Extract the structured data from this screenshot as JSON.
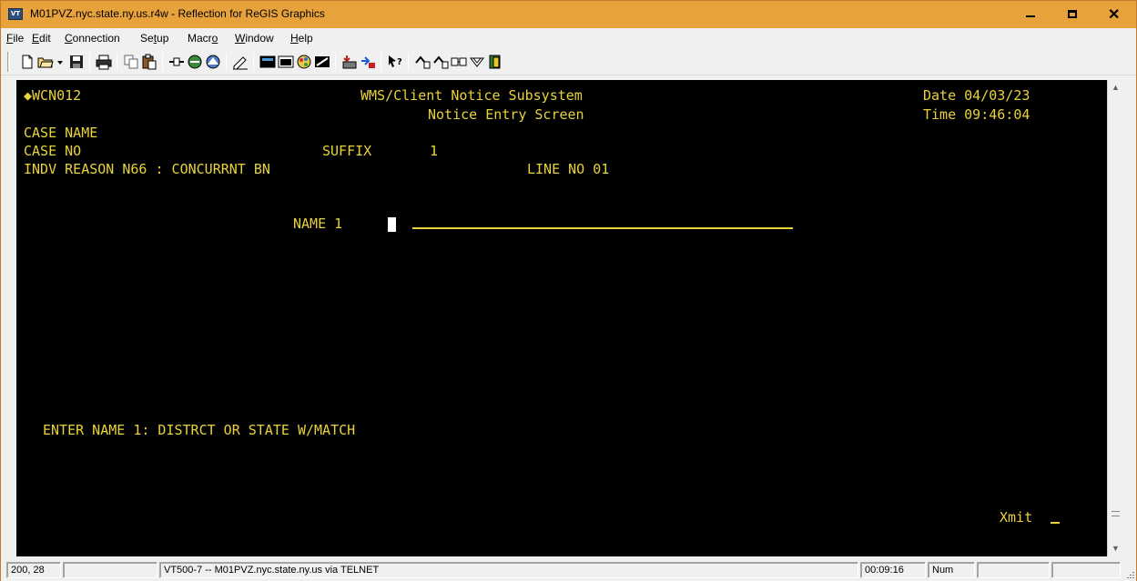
{
  "window": {
    "title": "M01PVZ.nyc.state.ny.us.r4w - Reflection for ReGIS Graphics",
    "icon_label": "VT",
    "buttons": [
      "minimize-icon",
      "maximize-icon",
      "close-icon"
    ]
  },
  "menu": {
    "items": [
      {
        "pre": "",
        "u": "F",
        "post": "ile"
      },
      {
        "pre": "",
        "u": "E",
        "post": "dit"
      },
      {
        "pre": "",
        "u": "C",
        "post": "onnection"
      },
      {
        "pre": "Se",
        "u": "t",
        "post": "up"
      },
      {
        "pre": "Macr",
        "u": "o",
        "post": ""
      },
      {
        "pre": "",
        "u": "W",
        "post": "indow"
      },
      {
        "pre": "",
        "u": "H",
        "post": "elp"
      }
    ]
  },
  "toolbar": {
    "icons": [
      "new-document-icon",
      "open-folder-icon",
      "save-icon",
      "print-icon",
      "copy-icon",
      "paste-icon",
      "connect-icon",
      "disconnect-icon",
      "connection-settings-icon",
      "edit-icon",
      "display-setup-icon",
      "terminal-setup-icon",
      "color-setup-icon",
      "keyboard-map-icon",
      "transfer-icon",
      "receive-icon",
      "help-pointer-icon",
      "macro-run-icon",
      "macro-record-icon",
      "macro-edit-icon",
      "shortcut-icon",
      "exit-icon"
    ]
  },
  "terminal": {
    "screen_id": "◆WCN012",
    "system_title": "WMS/Client Notice Subsystem",
    "screen_title": "Notice Entry Screen",
    "date_label": "Date 04/03/23",
    "time_label": "Time 09:46:04",
    "case_name_label": "CASE NAME",
    "case_no_label": "CASE NO",
    "suffix_label": "SUFFIX",
    "suffix_value": "1",
    "reason_line": "INDV REASON N66 : CONCURRNT BN",
    "line_no": "LINE NO 01",
    "name1_label": "NAME 1",
    "name1_value": "",
    "prompt": "ENTER NAME 1: DISTRCT OR STATE W/MATCH",
    "xmit_label": "Xmit",
    "text_color": "#e8d23a",
    "background": "#000000"
  },
  "status": {
    "cursor_pos": "200, 28",
    "connection": "VT500-7 -- M01PVZ.nyc.state.ny.us via TELNET",
    "elapsed": "00:09:16",
    "numlock": "Num"
  },
  "colors": {
    "titlebar": "#e8a23c",
    "terminal_text": "#e8d23a"
  }
}
